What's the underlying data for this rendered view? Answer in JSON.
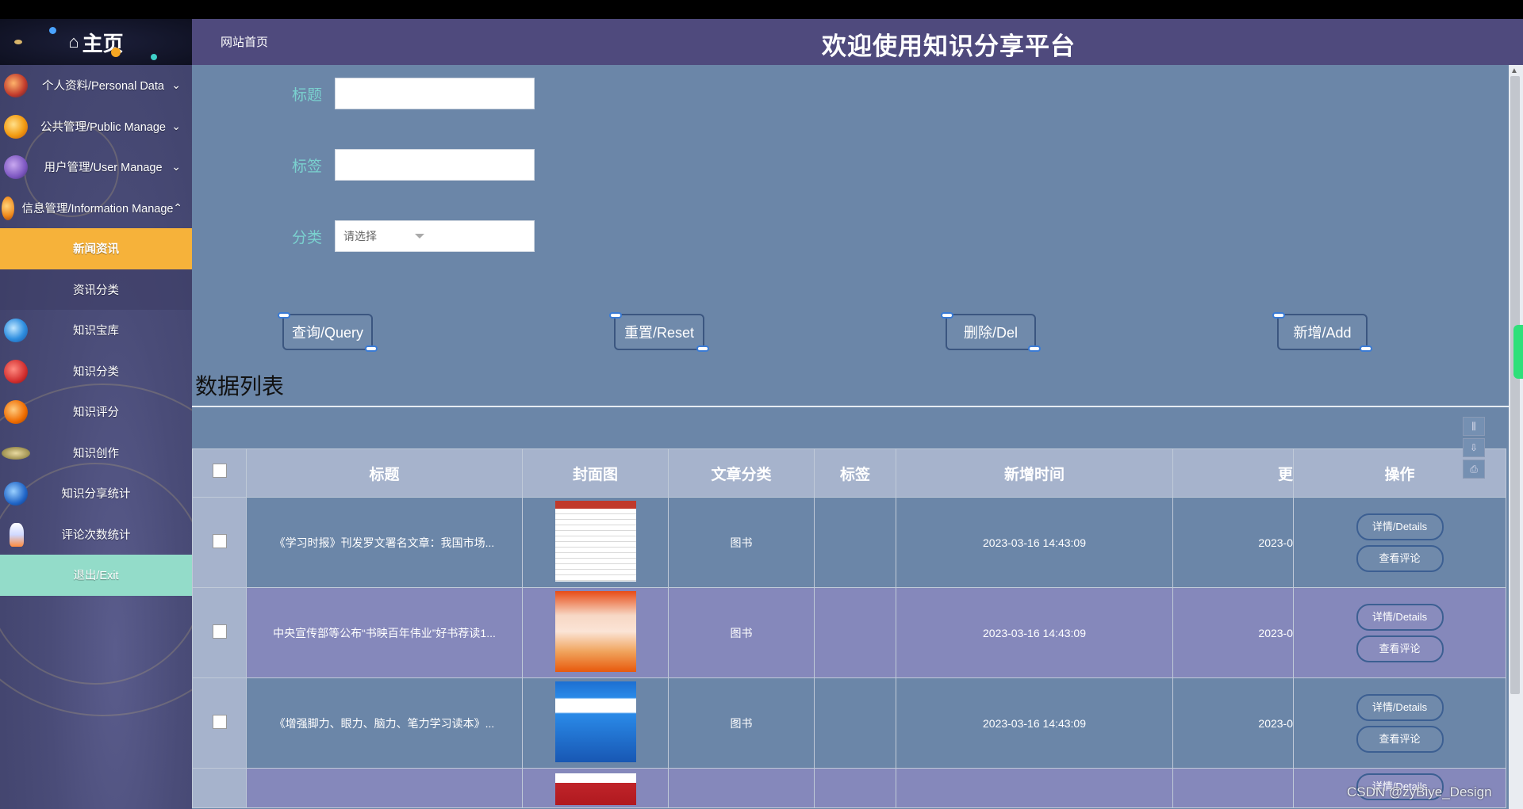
{
  "sidebar": {
    "home_label": "主页",
    "items": [
      {
        "label": "个人资料/Personal Data",
        "chevron": "⌄"
      },
      {
        "label": "公共管理/Public Manage",
        "chevron": "⌄"
      },
      {
        "label": "用户管理/User Manage",
        "chevron": "⌄"
      },
      {
        "label": "信息管理/Information Manage",
        "chevron": "⌃"
      },
      {
        "label": "新闻资讯"
      },
      {
        "label": "资讯分类"
      },
      {
        "label": "知识宝库"
      },
      {
        "label": "知识分类"
      },
      {
        "label": "知识评分"
      },
      {
        "label": "知识创作"
      },
      {
        "label": "知识分享统计"
      },
      {
        "label": "评论次数统计"
      },
      {
        "label": "退出/Exit"
      }
    ]
  },
  "header": {
    "site_home": "网站首页",
    "title": "欢迎使用知识分享平台"
  },
  "form": {
    "title_label": "标题",
    "title_value": "",
    "tag_label": "标签",
    "tag_value": "",
    "category_label": "分类",
    "category_placeholder": "请选择"
  },
  "actions": {
    "query": "查询/Query",
    "reset": "重置/Reset",
    "delete": "删除/Del",
    "add": "新增/Add"
  },
  "list": {
    "title": "数据列表",
    "columns": [
      "标题",
      "封面图",
      "文章分类",
      "标签",
      "新增时间",
      "更",
      "操作"
    ],
    "rows": [
      {
        "title": "《学习时报》刊发罗文署名文章：我国市场...",
        "category": "图书",
        "tag": "",
        "created": "2023-03-16 14:43:09",
        "updated": "2023-0",
        "details": "详情/Details",
        "comments": "查看评论"
      },
      {
        "title": "中央宣传部等公布“书映百年伟业”好书荐读1...",
        "category": "图书",
        "tag": "",
        "created": "2023-03-16 14:43:09",
        "updated": "2023-0",
        "details": "详情/Details",
        "comments": "查看评论"
      },
      {
        "title": "《增强脚力、眼力、脑力、笔力学习读本》...",
        "category": "图书",
        "tag": "",
        "created": "2023-03-16 14:43:09",
        "updated": "2023-0",
        "details": "详情/Details",
        "comments": "查看评论"
      },
      {
        "title": "",
        "category": "",
        "tag": "",
        "created": "",
        "updated": "",
        "details": "详情/Details",
        "comments": ""
      }
    ]
  },
  "watermark": "CSDN @zyBiye_Design",
  "colors": {
    "header_bg": "#4f4a7d",
    "main_bg": "#6b86a8",
    "active_menu": "#f6b23a",
    "exit_menu": "#93dcc9",
    "form_label": "#7ad1cf"
  }
}
